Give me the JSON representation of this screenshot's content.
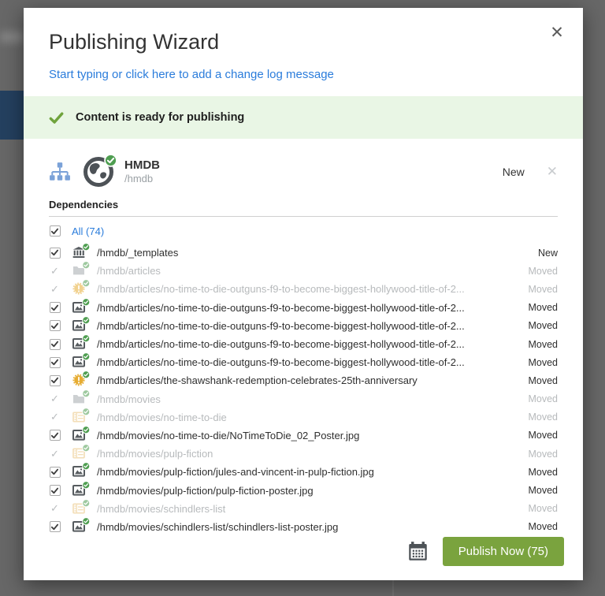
{
  "colors": {
    "accent_green": "#7aa33e",
    "banner_green_bg": "#e9f6e5",
    "check_green": "#6fa33c",
    "badge_green": "#4f9e51",
    "link_blue": "#2a7cdb",
    "sitemap_blue": "#7ba2d8",
    "icon_dark_gray": "#565b5f",
    "icon_folder_gray": "#a6abae",
    "icon_yellow": "#e6ac32",
    "icon_film_tan": "#eac47e",
    "overlay_gray": "#676767",
    "navy_bar": "#24405f"
  },
  "modal": {
    "title": "Publishing Wizard",
    "close_glyph": "✕",
    "changelog_prompt": "Start typing or click here to add a change log message",
    "banner": {
      "icon": "check-icon",
      "text": "Content is ready for publishing"
    },
    "item": {
      "icons": [
        "sitemap-icon",
        "globe-icon",
        "check-badge-icon"
      ],
      "name": "HMDB",
      "path": "/hmdb",
      "status": "New",
      "remove_glyph": "✕"
    },
    "dependencies": {
      "heading": "Dependencies",
      "select_all_label": "All (74)",
      "locked_glyph": "✓",
      "rows": [
        {
          "icon": "template-icon",
          "path": "/hmdb/_templates",
          "status": "New",
          "state": "checked"
        },
        {
          "icon": "folder-icon",
          "path": "/hmdb/articles",
          "status": "Moved",
          "state": "locked"
        },
        {
          "icon": "component-icon",
          "path": "/hmdb/articles/no-time-to-die-outguns-f9-to-become-biggest-hollywood-title-of-2...",
          "status": "Moved",
          "state": "locked"
        },
        {
          "icon": "image-icon",
          "path": "/hmdb/articles/no-time-to-die-outguns-f9-to-become-biggest-hollywood-title-of-2...",
          "status": "Moved",
          "state": "checked"
        },
        {
          "icon": "image-icon",
          "path": "/hmdb/articles/no-time-to-die-outguns-f9-to-become-biggest-hollywood-title-of-2...",
          "status": "Moved",
          "state": "checked"
        },
        {
          "icon": "image-icon",
          "path": "/hmdb/articles/no-time-to-die-outguns-f9-to-become-biggest-hollywood-title-of-2...",
          "status": "Moved",
          "state": "checked"
        },
        {
          "icon": "image-icon",
          "path": "/hmdb/articles/no-time-to-die-outguns-f9-to-become-biggest-hollywood-title-of-2...",
          "status": "Moved",
          "state": "checked"
        },
        {
          "icon": "component-icon",
          "path": "/hmdb/articles/the-shawshank-redemption-celebrates-25th-anniversary",
          "status": "Moved",
          "state": "checked"
        },
        {
          "icon": "folder-icon",
          "path": "/hmdb/movies",
          "status": "Moved",
          "state": "locked"
        },
        {
          "icon": "film-icon",
          "path": "/hmdb/movies/no-time-to-die",
          "status": "Moved",
          "state": "locked"
        },
        {
          "icon": "image-icon",
          "path": "/hmdb/movies/no-time-to-die/NoTimeToDie_02_Poster.jpg",
          "status": "Moved",
          "state": "checked"
        },
        {
          "icon": "film-icon",
          "path": "/hmdb/movies/pulp-fiction",
          "status": "Moved",
          "state": "locked"
        },
        {
          "icon": "image-icon",
          "path": "/hmdb/movies/pulp-fiction/jules-and-vincent-in-pulp-fiction.jpg",
          "status": "Moved",
          "state": "checked"
        },
        {
          "icon": "image-icon",
          "path": "/hmdb/movies/pulp-fiction/pulp-fiction-poster.jpg",
          "status": "Moved",
          "state": "checked"
        },
        {
          "icon": "film-icon",
          "path": "/hmdb/movies/schindlers-list",
          "status": "Moved",
          "state": "locked"
        },
        {
          "icon": "image-icon",
          "path": "/hmdb/movies/schindlers-list/schindlers-list-poster.jpg",
          "status": "Moved",
          "state": "checked"
        }
      ]
    },
    "footer": {
      "schedule_icon": "calendar-icon",
      "publish_label": "Publish Now (75)"
    }
  }
}
